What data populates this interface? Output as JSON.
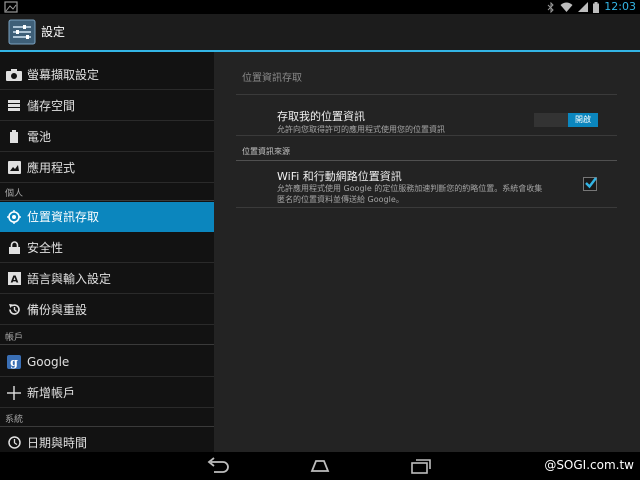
{
  "status_bar": {
    "time": "12:03",
    "icons": [
      "image-icon",
      "bluetooth-icon",
      "wifi-icon",
      "signal-icon",
      "battery-icon"
    ]
  },
  "action_bar": {
    "title": "設定",
    "icon": "settings-icon"
  },
  "sidebar": {
    "items": [
      {
        "label": "螢幕擷取設定",
        "icon": "camera-icon"
      },
      {
        "label": "儲存空間",
        "icon": "storage-icon"
      },
      {
        "label": "電池",
        "icon": "battery-icon"
      },
      {
        "label": "應用程式",
        "icon": "apps-icon"
      },
      {
        "label": "位置資訊存取",
        "icon": "location-icon",
        "active": true
      },
      {
        "label": "安全性",
        "icon": "lock-icon"
      },
      {
        "label": "語言與輸入設定",
        "icon": "keyboard-icon"
      },
      {
        "label": "備份與重設",
        "icon": "backup-icon"
      },
      {
        "label": "Google",
        "icon": "google-icon"
      },
      {
        "label": "新增帳戶",
        "icon": "plus-icon"
      },
      {
        "label": "日期與時間",
        "icon": "clock-icon"
      }
    ],
    "headers": {
      "personal": "個人",
      "accounts": "帳戶",
      "system": "系統"
    }
  },
  "detail": {
    "title": "位置資訊存取",
    "access": {
      "title": "存取我的位置資訊",
      "summary": "允許向您取得許可的應用程式使用您的位置資訊",
      "toggle_label": "開啟"
    },
    "section": "位置資訊來源",
    "wifi": {
      "title": "WiFi 和行動網路位置資訊",
      "summary_line1": "允許應用程式使用 Google 的定位服務加速判斷您的約略位置。系統會收集",
      "summary_line2": "匿名的位置資料並傳送給 Google。",
      "checked": true
    }
  },
  "watermark": "@SOGI.com.tw",
  "colors": {
    "accent": "#33b5e5",
    "selected": "#0b86be",
    "pane_bg": "#232323",
    "list_bg": "#121212"
  }
}
